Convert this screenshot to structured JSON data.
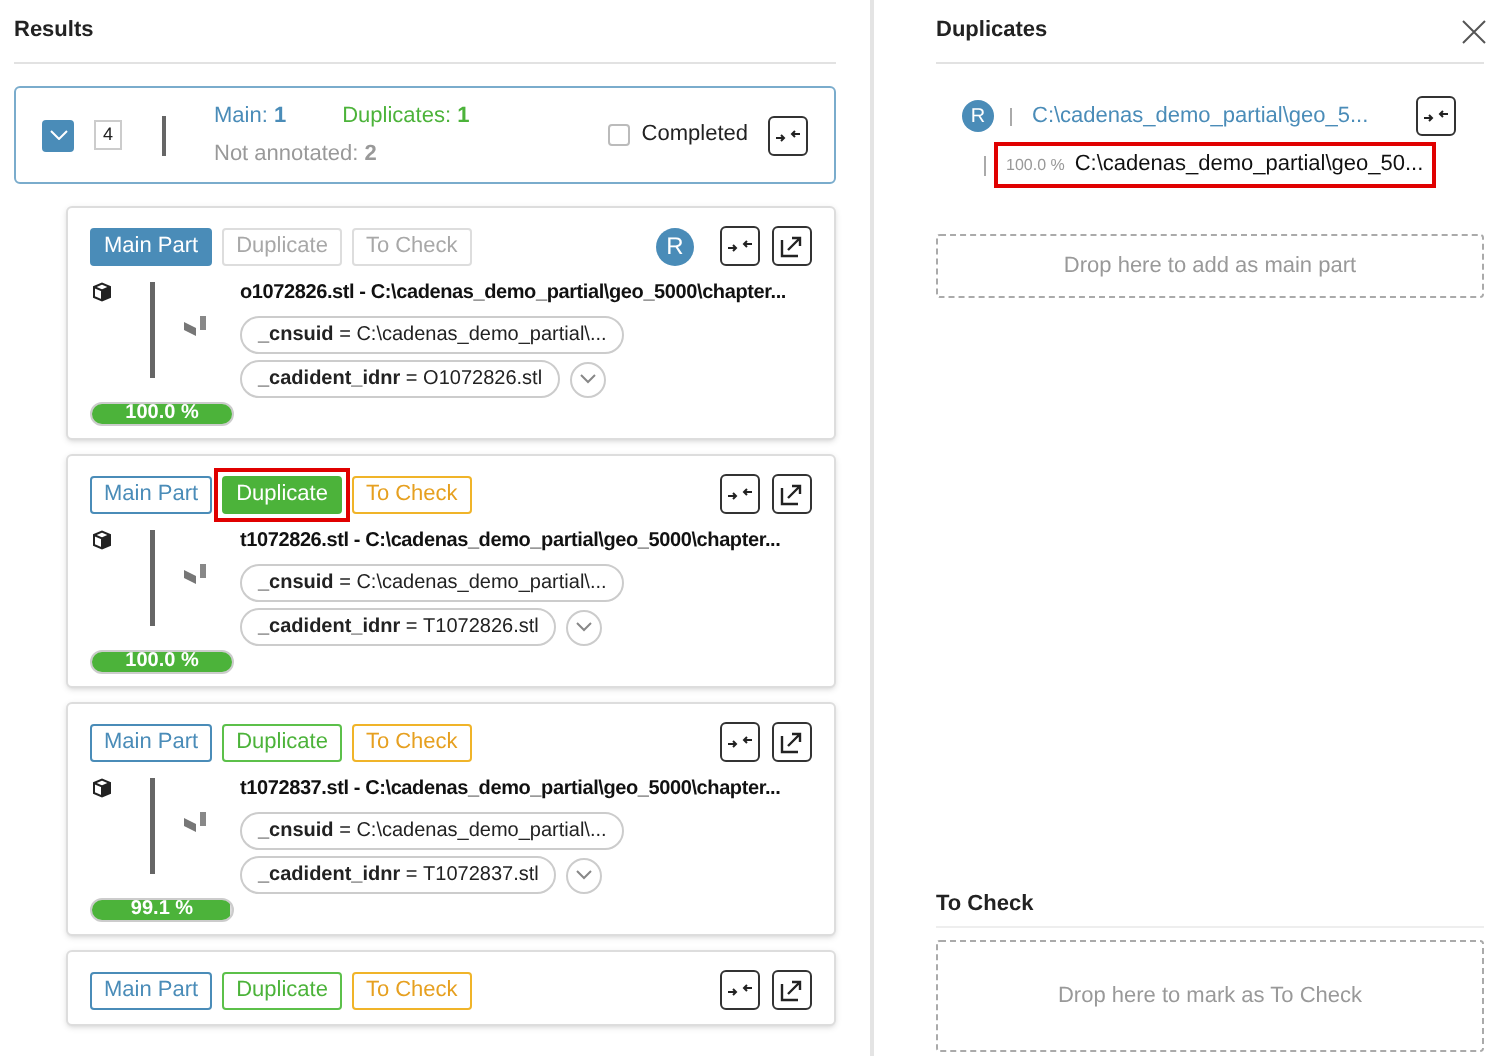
{
  "results": {
    "title": "Results",
    "group": {
      "expanded": true,
      "count": "4",
      "main_label": "Main:",
      "main_count": "1",
      "dup_label": "Duplicates:",
      "dup_count": "1",
      "not_label": "Not annotated:",
      "not_count": "2",
      "completed": {
        "label": "Completed",
        "checked": false
      }
    },
    "cards": [
      {
        "tags": [
          {
            "kind": "main",
            "label": "Main Part",
            "selected": true,
            "disabled": false,
            "highlighted": false
          },
          {
            "kind": "duplicate",
            "label": "Duplicate",
            "selected": false,
            "disabled": true,
            "highlighted": false
          },
          {
            "kind": "check",
            "label": "To Check",
            "selected": false,
            "disabled": true,
            "highlighted": false
          }
        ],
        "avatar": "R",
        "title": "o1072826.stl - C:\\cadenas_demo_partial\\geo_5000\\chapter...",
        "props": [
          {
            "key": "_cnsuid",
            "sep": "=",
            "value": "C:\\cadenas_demo_partial\\..."
          },
          {
            "key": "_cadident_idnr",
            "sep": "=",
            "value": "O1072826.stl"
          }
        ],
        "score": "100.0 %",
        "level": 1.0
      },
      {
        "tags": [
          {
            "kind": "main",
            "label": "Main Part",
            "selected": false,
            "disabled": false,
            "highlighted": false
          },
          {
            "kind": "duplicate",
            "label": "Duplicate",
            "selected": true,
            "disabled": false,
            "highlighted": true
          },
          {
            "kind": "check",
            "label": "To Check",
            "selected": false,
            "disabled": false,
            "highlighted": false
          }
        ],
        "title": "t1072826.stl - C:\\cadenas_demo_partial\\geo_5000\\chapter...",
        "props": [
          {
            "key": "_cnsuid",
            "sep": "=",
            "value": "C:\\cadenas_demo_partial\\..."
          },
          {
            "key": "_cadident_idnr",
            "sep": "=",
            "value": "T1072826.stl"
          }
        ],
        "score": "100.0 %",
        "level": 1.0
      },
      {
        "tags": [
          {
            "kind": "main",
            "label": "Main Part",
            "selected": false,
            "disabled": false,
            "highlighted": false
          },
          {
            "kind": "duplicate",
            "label": "Duplicate",
            "selected": false,
            "disabled": false,
            "highlighted": false
          },
          {
            "kind": "check",
            "label": "To Check",
            "selected": false,
            "disabled": false,
            "highlighted": false
          }
        ],
        "title": "t1072837.stl - C:\\cadenas_demo_partial\\geo_5000\\chapter...",
        "props": [
          {
            "key": "_cnsuid",
            "sep": "=",
            "value": "C:\\cadenas_demo_partial\\..."
          },
          {
            "key": "_cadident_idnr",
            "sep": "=",
            "value": "T1072837.stl"
          }
        ],
        "score": "99.1 %",
        "level": 0.991
      },
      {
        "tags": [
          {
            "kind": "main",
            "label": "Main Part",
            "selected": false,
            "disabled": false,
            "highlighted": false
          },
          {
            "kind": "duplicate",
            "label": "Duplicate",
            "selected": false,
            "disabled": false,
            "highlighted": false
          },
          {
            "kind": "check",
            "label": "To Check",
            "selected": false,
            "disabled": false,
            "highlighted": false
          }
        ]
      }
    ]
  },
  "duplicates": {
    "title": "Duplicates",
    "main": {
      "avatar": "R",
      "path": "C:\\cadenas_demo_partial\\geo_5..."
    },
    "items": [
      {
        "score": "100.0 %",
        "path": "C:\\cadenas_demo_partial\\geo_50...",
        "highlighted": true
      }
    ],
    "drop_hint": "Drop here to add as main part"
  },
  "to_check": {
    "title": "To Check",
    "drop_hint": "Drop here to mark as To Check"
  }
}
